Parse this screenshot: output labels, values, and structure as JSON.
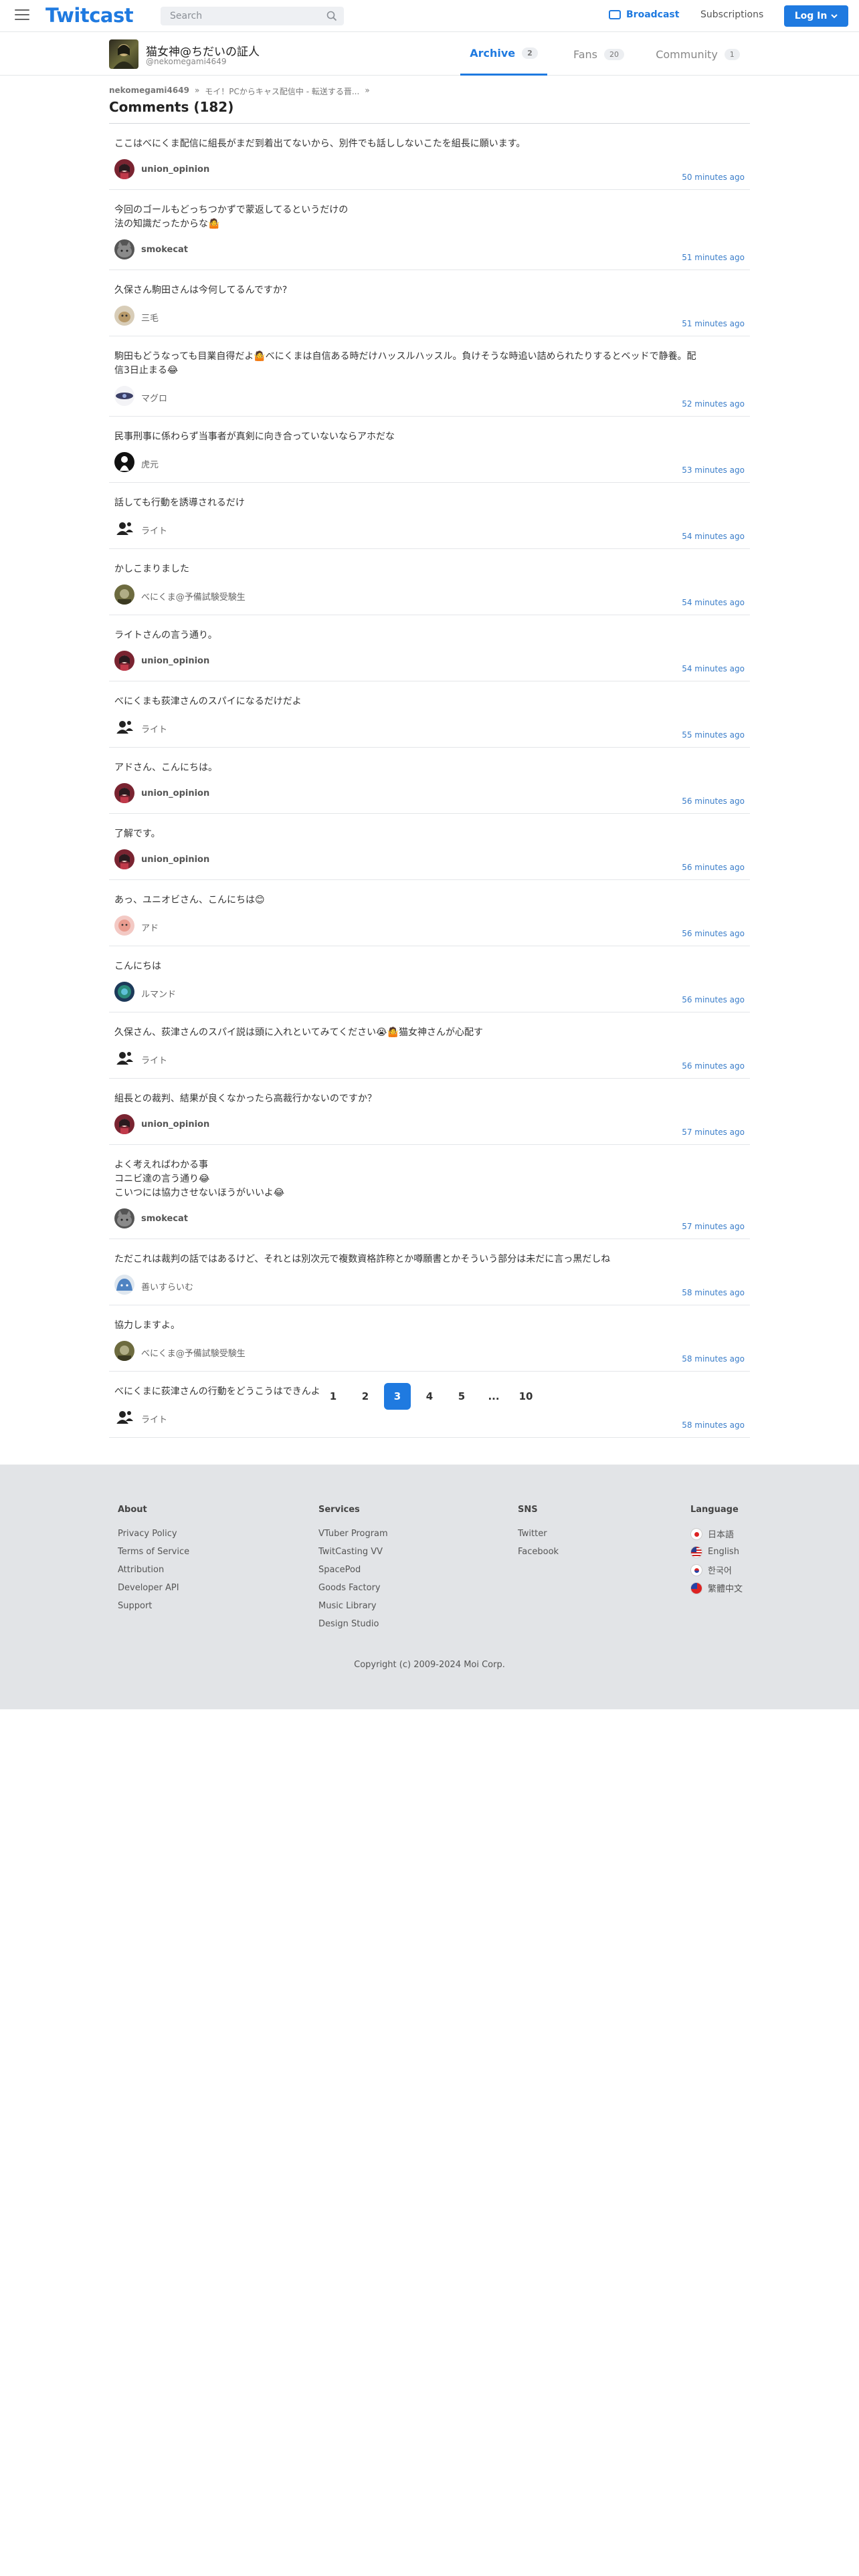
{
  "nav": {
    "logo": "Twitcast",
    "search_placeholder": "Search",
    "broadcast": "Broadcast",
    "subscriptions": "Subscriptions",
    "login": "Log In"
  },
  "profile": {
    "name": "猫女神@ちだいの証人",
    "handle": "@nekomegami4649",
    "tabs": [
      {
        "label": "Archive",
        "count": "2"
      },
      {
        "label": "Fans",
        "count": "20"
      },
      {
        "label": "Community",
        "count": "1"
      }
    ]
  },
  "breadcrumb": [
    "nekomegami4649",
    "»",
    "モイ！PCからキャス配信中 - 転送する晋...",
    "»"
  ],
  "comments_title": "Comments (182)",
  "comments": [
    {
      "text": "ここはべにくま配信に組長がまだ到着出てないから、別件でも話ししないこたを組長に願います。",
      "user": "union_opinion",
      "time": "50 minutes ago",
      "avatar": "girl-red"
    },
    {
      "text": "今回のゴールもどっちつかずで蒙返してるというだけの\n法の知識だったからな🤷",
      "user": "smokecat",
      "time": "51 minutes ago",
      "avatar": "cat"
    },
    {
      "text": "久保さん駒田さんは今何してるんですか?",
      "user": "三毛",
      "time": "51 minutes ago",
      "avatar": "cat-photo"
    },
    {
      "text": "駒田もどうなっても目業自得だよ🤷べにくまは自信ある時だけハッスルハッスル。負けそうな時追い詰められたりするとベッドで静養。配信3日止まる😂",
      "user": "マグロ",
      "time": "52 minutes ago",
      "avatar": "eye"
    },
    {
      "text": "民事刑事に係わらず当事者が真剣に向き合っていないならアホだな",
      "user": "虎元",
      "time": "53 minutes ago",
      "avatar": "tiger"
    },
    {
      "text": "話しても行動を誘導されるだけ",
      "user": "ライト",
      "time": "54 minutes ago",
      "avatar": "default"
    },
    {
      "text": "かしこまりました",
      "user": "べにくま@予備試験受験生",
      "time": "54 minutes ago",
      "avatar": "olive"
    },
    {
      "text": "ライトさんの言う通り。",
      "user": "union_opinion",
      "time": "54 minutes ago",
      "avatar": "girl-red"
    },
    {
      "text": "べにくまも荻津さんのスパイになるだけだよ",
      "user": "ライト",
      "time": "55 minutes ago",
      "avatar": "default"
    },
    {
      "text": "アドさん、こんにちは。",
      "user": "union_opinion",
      "time": "56 minutes ago",
      "avatar": "girl-red"
    },
    {
      "text": "了解です。",
      "user": "union_opinion",
      "time": "56 minutes ago",
      "avatar": "girl-red"
    },
    {
      "text": "あっ、ユニオビさん、こんにちは😊",
      "user": "アド",
      "time": "56 minutes ago",
      "avatar": "pink"
    },
    {
      "text": "こんにちは",
      "user": "ルマンド",
      "time": "56 minutes ago",
      "avatar": "blue-green"
    },
    {
      "text": "久保さん、荻津さんのスパイ説は頭に入れといてみてください😭🤷猫女神さんが心配す",
      "user": "ライト",
      "time": "56 minutes ago",
      "avatar": "default"
    },
    {
      "text": "組長との裁判、結果が良くなかったら高裁行かないのですか？",
      "user": "union_opinion",
      "time": "57 minutes ago",
      "avatar": "girl-red"
    },
    {
      "text": "よく考えればわかる事\nコニビ達の言う通り😂\nこいつには協力させないほうがいいよ😂",
      "user": "smokecat",
      "time": "57 minutes ago",
      "avatar": "cat"
    },
    {
      "text": "ただこれは裁判の話ではあるけど、それとは別次元で複数資格詐称とか噂願書とかそういう部分は未だに言っ黒だしね",
      "user": "善いすらいむ",
      "time": "58 minutes ago",
      "avatar": "slime"
    },
    {
      "text": "協力しますよ。",
      "user": "べにくま@予備試験受験生",
      "time": "58 minutes ago",
      "avatar": "olive"
    },
    {
      "text": "べにくまに荻津さんの行動をどうこうはできんよ",
      "user": "ライト",
      "time": "58 minutes ago",
      "avatar": "default"
    }
  ],
  "pagination": [
    "1",
    "2",
    "3",
    "4",
    "5",
    "...",
    "10"
  ],
  "pagination_active": "3",
  "footer": {
    "about": {
      "title": "About",
      "links": [
        "Privacy Policy",
        "Terms of Service",
        "Attribution",
        "Developer API",
        "Support"
      ]
    },
    "services": {
      "title": "Services",
      "links": [
        "VTuber Program",
        "TwitCasting VV",
        "SpacePod",
        "Goods Factory",
        "Music Library",
        "Design Studio"
      ]
    },
    "sns": {
      "title": "SNS",
      "links": [
        "Twitter",
        "Facebook"
      ]
    },
    "language": {
      "title": "Language",
      "links": [
        "日本語",
        "English",
        "한국어",
        "繁體中文"
      ]
    },
    "copyright": "Copyright (c) 2009-2024 Moi Corp."
  },
  "colors": {
    "accent": "#1f7ae0",
    "time": "#3a7dc9",
    "footer_bg": "#e2e4e7"
  }
}
